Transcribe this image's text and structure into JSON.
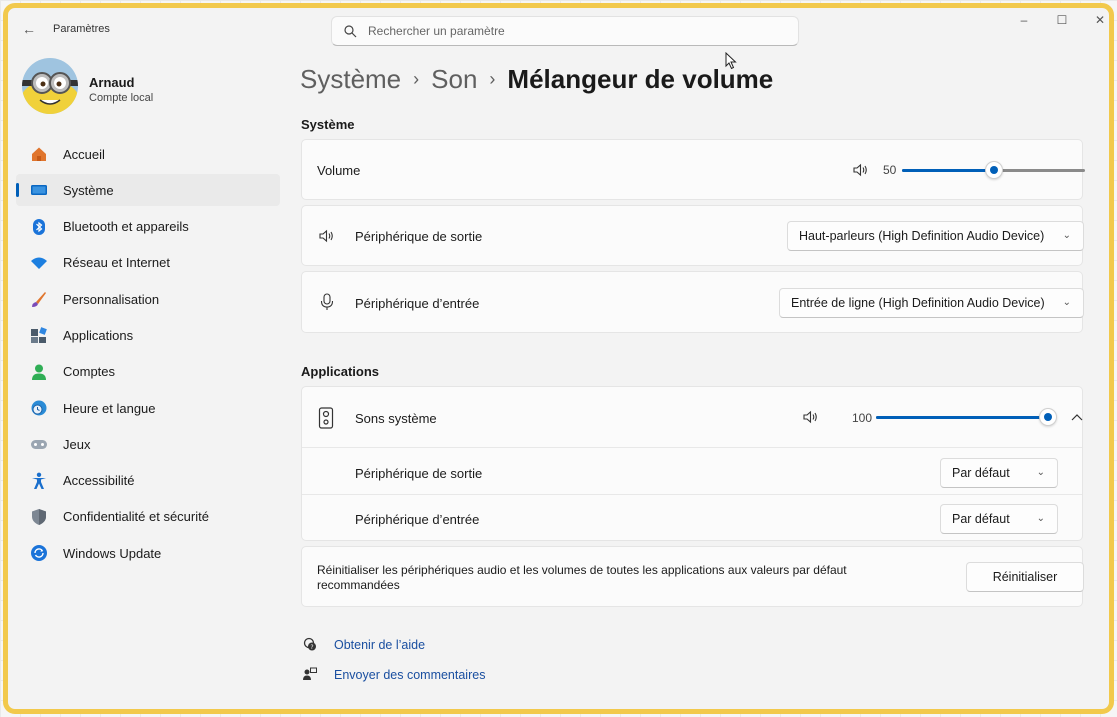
{
  "window": {
    "title": "Paramètres",
    "controls": {
      "minimize": "–",
      "maximize": "☐",
      "close": "✕"
    }
  },
  "search": {
    "placeholder": "Rechercher un paramètre"
  },
  "profile": {
    "name": "Arnaud",
    "account_type": "Compte local"
  },
  "sidebar": {
    "items": [
      {
        "label": "Accueil",
        "icon": "home-icon",
        "active": false
      },
      {
        "label": "Système",
        "icon": "system-icon",
        "active": true
      },
      {
        "label": "Bluetooth et appareils",
        "icon": "bluetooth-icon",
        "active": false
      },
      {
        "label": "Réseau et Internet",
        "icon": "wifi-icon",
        "active": false
      },
      {
        "label": "Personnalisation",
        "icon": "brush-icon",
        "active": false
      },
      {
        "label": "Applications",
        "icon": "apps-icon",
        "active": false
      },
      {
        "label": "Comptes",
        "icon": "account-icon",
        "active": false
      },
      {
        "label": "Heure et langue",
        "icon": "clock-globe-icon",
        "active": false
      },
      {
        "label": "Jeux",
        "icon": "gamepad-icon",
        "active": false
      },
      {
        "label": "Accessibilité",
        "icon": "accessibility-icon",
        "active": false
      },
      {
        "label": "Confidentialité et sécurité",
        "icon": "shield-icon",
        "active": false
      },
      {
        "label": "Windows Update",
        "icon": "update-icon",
        "active": false
      }
    ]
  },
  "breadcrumb": {
    "level1": "Système",
    "level2": "Son",
    "current": "Mélangeur de volume",
    "separator": "›"
  },
  "system_section": {
    "title": "Système",
    "volume": {
      "label": "Volume",
      "value": 50,
      "value_text": "50"
    },
    "output": {
      "label": "Périphérique de sortie",
      "selected": "Haut-parleurs (High Definition Audio Device)"
    },
    "input": {
      "label": "Périphérique d’entrée",
      "selected": "Entrée de ligne (High Definition Audio Device)"
    }
  },
  "apps_section": {
    "title": "Applications",
    "app": {
      "name": "Sons système",
      "volume": 100,
      "volume_text": "100",
      "output_label": "Périphérique de sortie",
      "output_selected": "Par défaut",
      "input_label": "Périphérique d’entrée",
      "input_selected": "Par défaut"
    }
  },
  "reset": {
    "text_line1": "Réinitialiser les périphériques audio et les volumes de toutes les applications aux valeurs par défaut",
    "text_line2": "recommandées",
    "button": "Réinitialiser"
  },
  "footer": {
    "help": "Obtenir de l’aide",
    "feedback": "Envoyer des commentaires"
  },
  "colors": {
    "accent": "#005fb8",
    "highlight_border": "#f2c94c"
  }
}
